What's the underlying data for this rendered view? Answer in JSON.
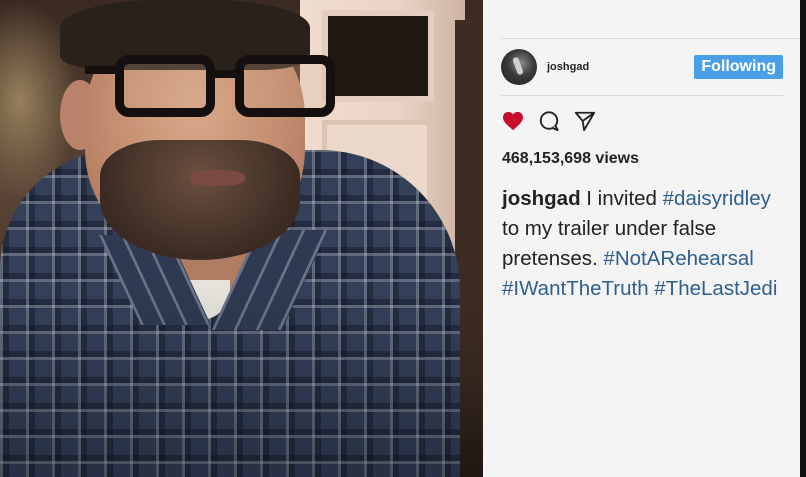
{
  "post": {
    "username": "joshgad",
    "follow_label": "Following",
    "views": "468,153,698 views",
    "caption": {
      "author": "joshgad",
      "text_1": " I invited ",
      "tag_1": "#daisyridley",
      "text_2": " to my trailer under false pretenses. ",
      "tag_2": "#NotARehearsal",
      "text_3": " ",
      "tag_3": "#IWantTheTruth",
      "text_4": " ",
      "tag_4": "#TheLastJedi"
    },
    "actions": {
      "like_icon": "heart-icon",
      "comment_icon": "comment-icon",
      "share_icon": "send-icon"
    }
  },
  "colors": {
    "follow_button": "#4aa0e6",
    "heart": "#c8102e",
    "hashtag": "#2e5f8f",
    "panel_bg": "#f4f4f4"
  }
}
